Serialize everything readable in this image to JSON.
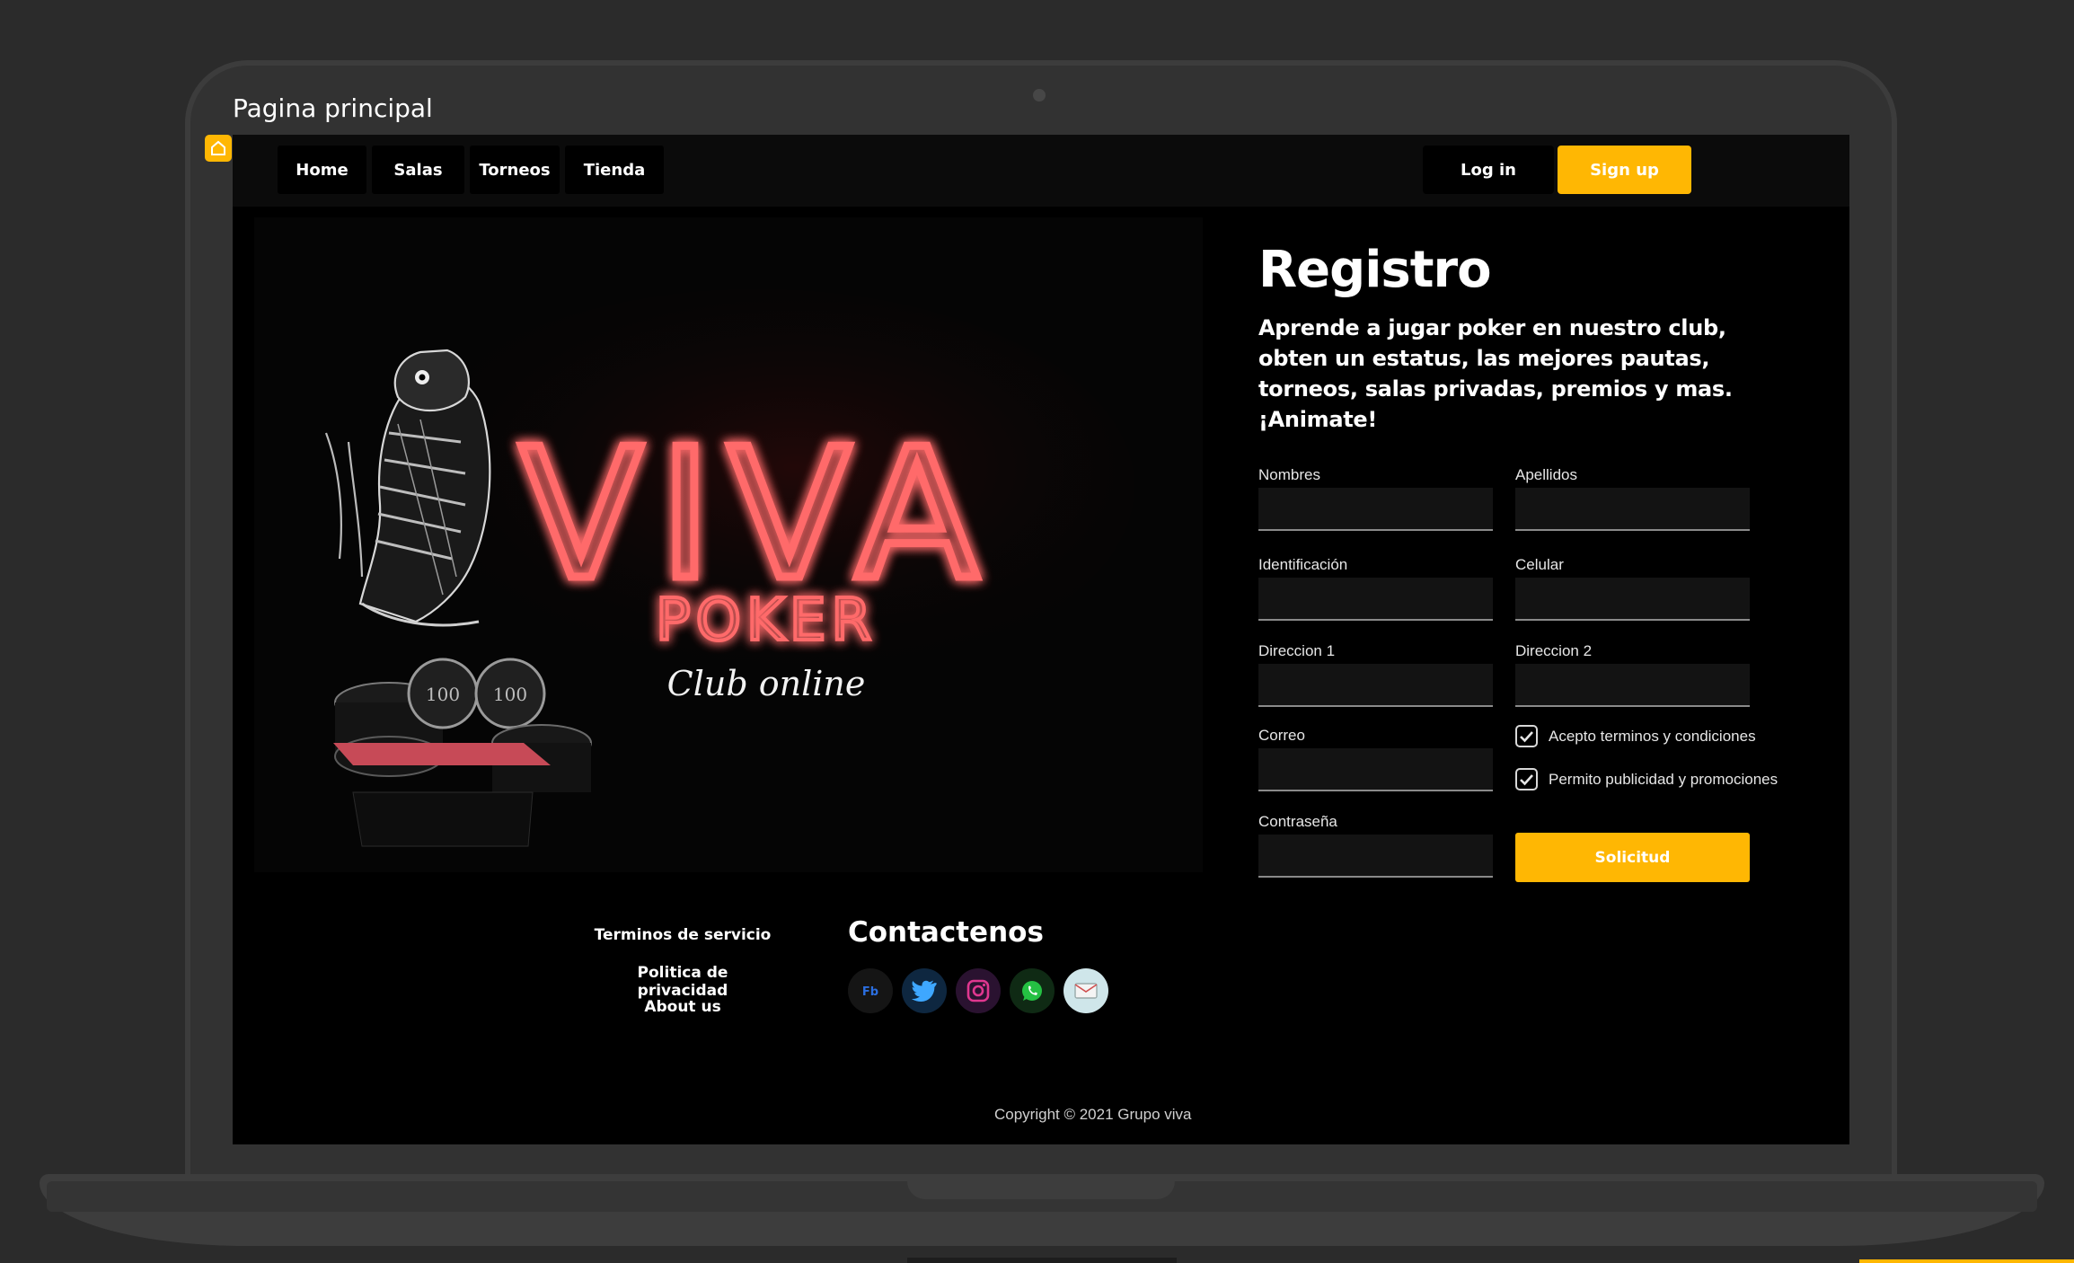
{
  "window": {
    "title": "Pagina principal"
  },
  "nav": {
    "items": [
      "Home",
      "Salas",
      "Torneos",
      "Tienda"
    ]
  },
  "auth": {
    "login": "Log in",
    "signup": "Sign up"
  },
  "hero": {
    "brand": "VIVA",
    "sub": "POKER",
    "tagline": "Club online"
  },
  "registro": {
    "title": "Registro",
    "description": "Aprende a jugar poker en nuestro club, obten un estatus, las mejores pautas, torneos, salas privadas, premios y mas. ¡Animate!",
    "fields": {
      "nombres": {
        "label": "Nombres",
        "value": ""
      },
      "apellidos": {
        "label": "Apellidos",
        "value": ""
      },
      "identificacion": {
        "label": "Identificación",
        "value": ""
      },
      "celular": {
        "label": "Celular",
        "value": ""
      },
      "direccion1": {
        "label": "Direccion 1",
        "value": ""
      },
      "direccion2": {
        "label": "Direccion 2",
        "value": ""
      },
      "correo": {
        "label": "Correo",
        "value": ""
      },
      "contrasena": {
        "label": "Contraseña",
        "value": ""
      }
    },
    "checkboxes": {
      "terminos": {
        "label": "Acepto terminos y condiciones",
        "checked": true
      },
      "publicidad": {
        "label": "Permito publicidad y promociones",
        "checked": true
      }
    },
    "submit": "Solicitud"
  },
  "footer": {
    "links": [
      "Terminos de servicio",
      "Politica de privacidad",
      "About us"
    ],
    "contact_title": "Contactenos",
    "socials": [
      "facebook-icon",
      "twitter-icon",
      "instagram-icon",
      "whatsapp-icon",
      "email-icon"
    ],
    "copyright": "Copyright © 2021 Grupo viva"
  },
  "colors": {
    "accent": "#ffb703",
    "neon": "#ff5a5a",
    "background": "#000000",
    "frame": "#323232"
  }
}
